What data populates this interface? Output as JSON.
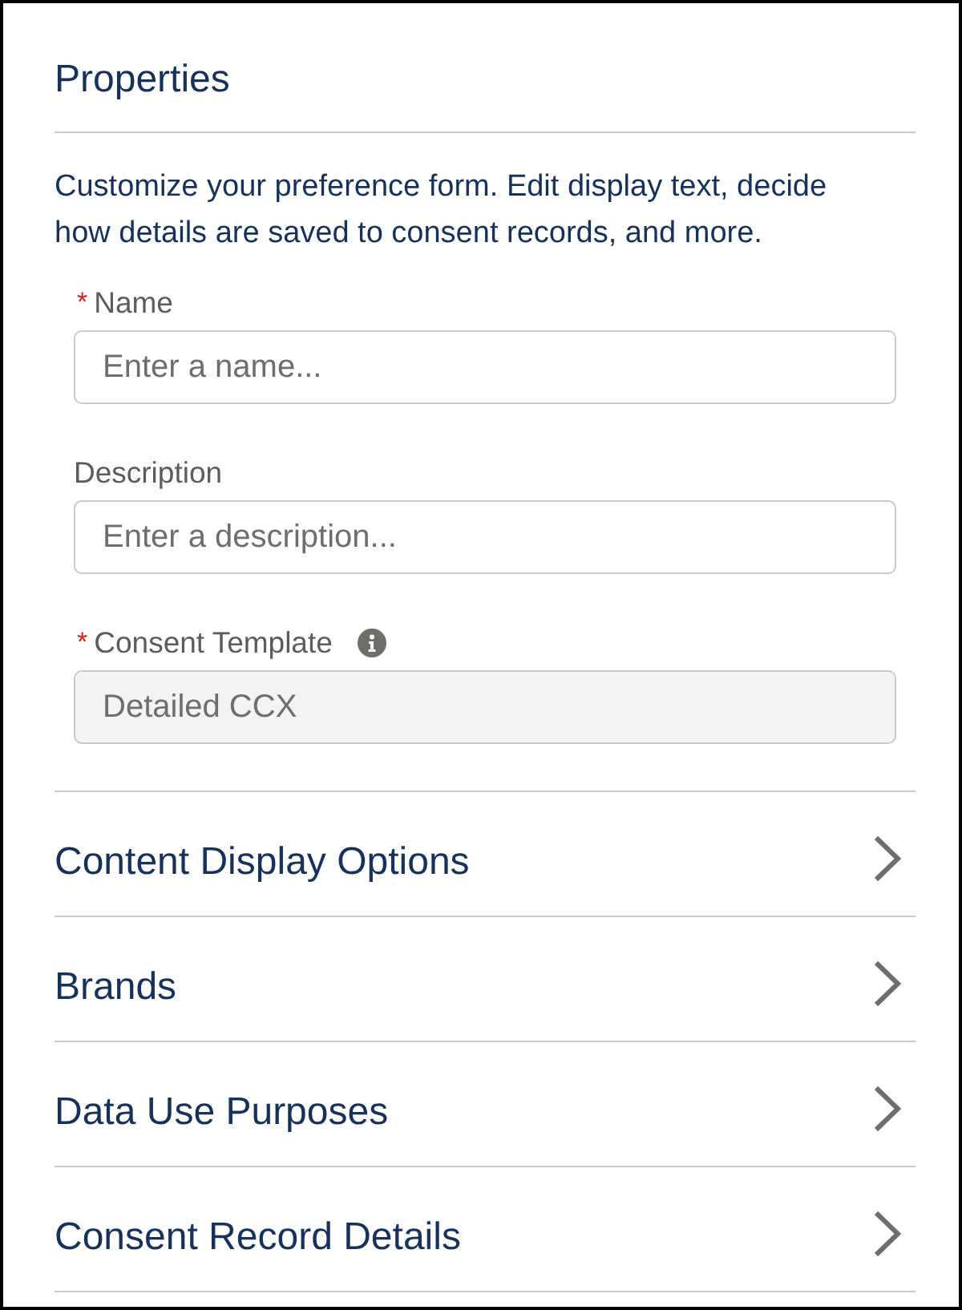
{
  "panel": {
    "title": "Properties",
    "description": "Customize your preference form. Edit display text, decide how details are saved to consent records, and more."
  },
  "fields": [
    {
      "label": "Name",
      "required_mark": "*",
      "placeholder": "Enter a name...",
      "disabled": false,
      "info": false
    },
    {
      "label": "Description",
      "placeholder": "Enter a description...",
      "disabled": false,
      "info": false
    },
    {
      "label": "Consent Template",
      "required_mark": "*",
      "value": "Detailed CCX",
      "disabled": true,
      "info": true
    }
  ],
  "sections": [
    {
      "label": "Content Display Options"
    },
    {
      "label": "Brands"
    },
    {
      "label": "Data Use Purposes"
    },
    {
      "label": "Consent Record Details"
    }
  ]
}
